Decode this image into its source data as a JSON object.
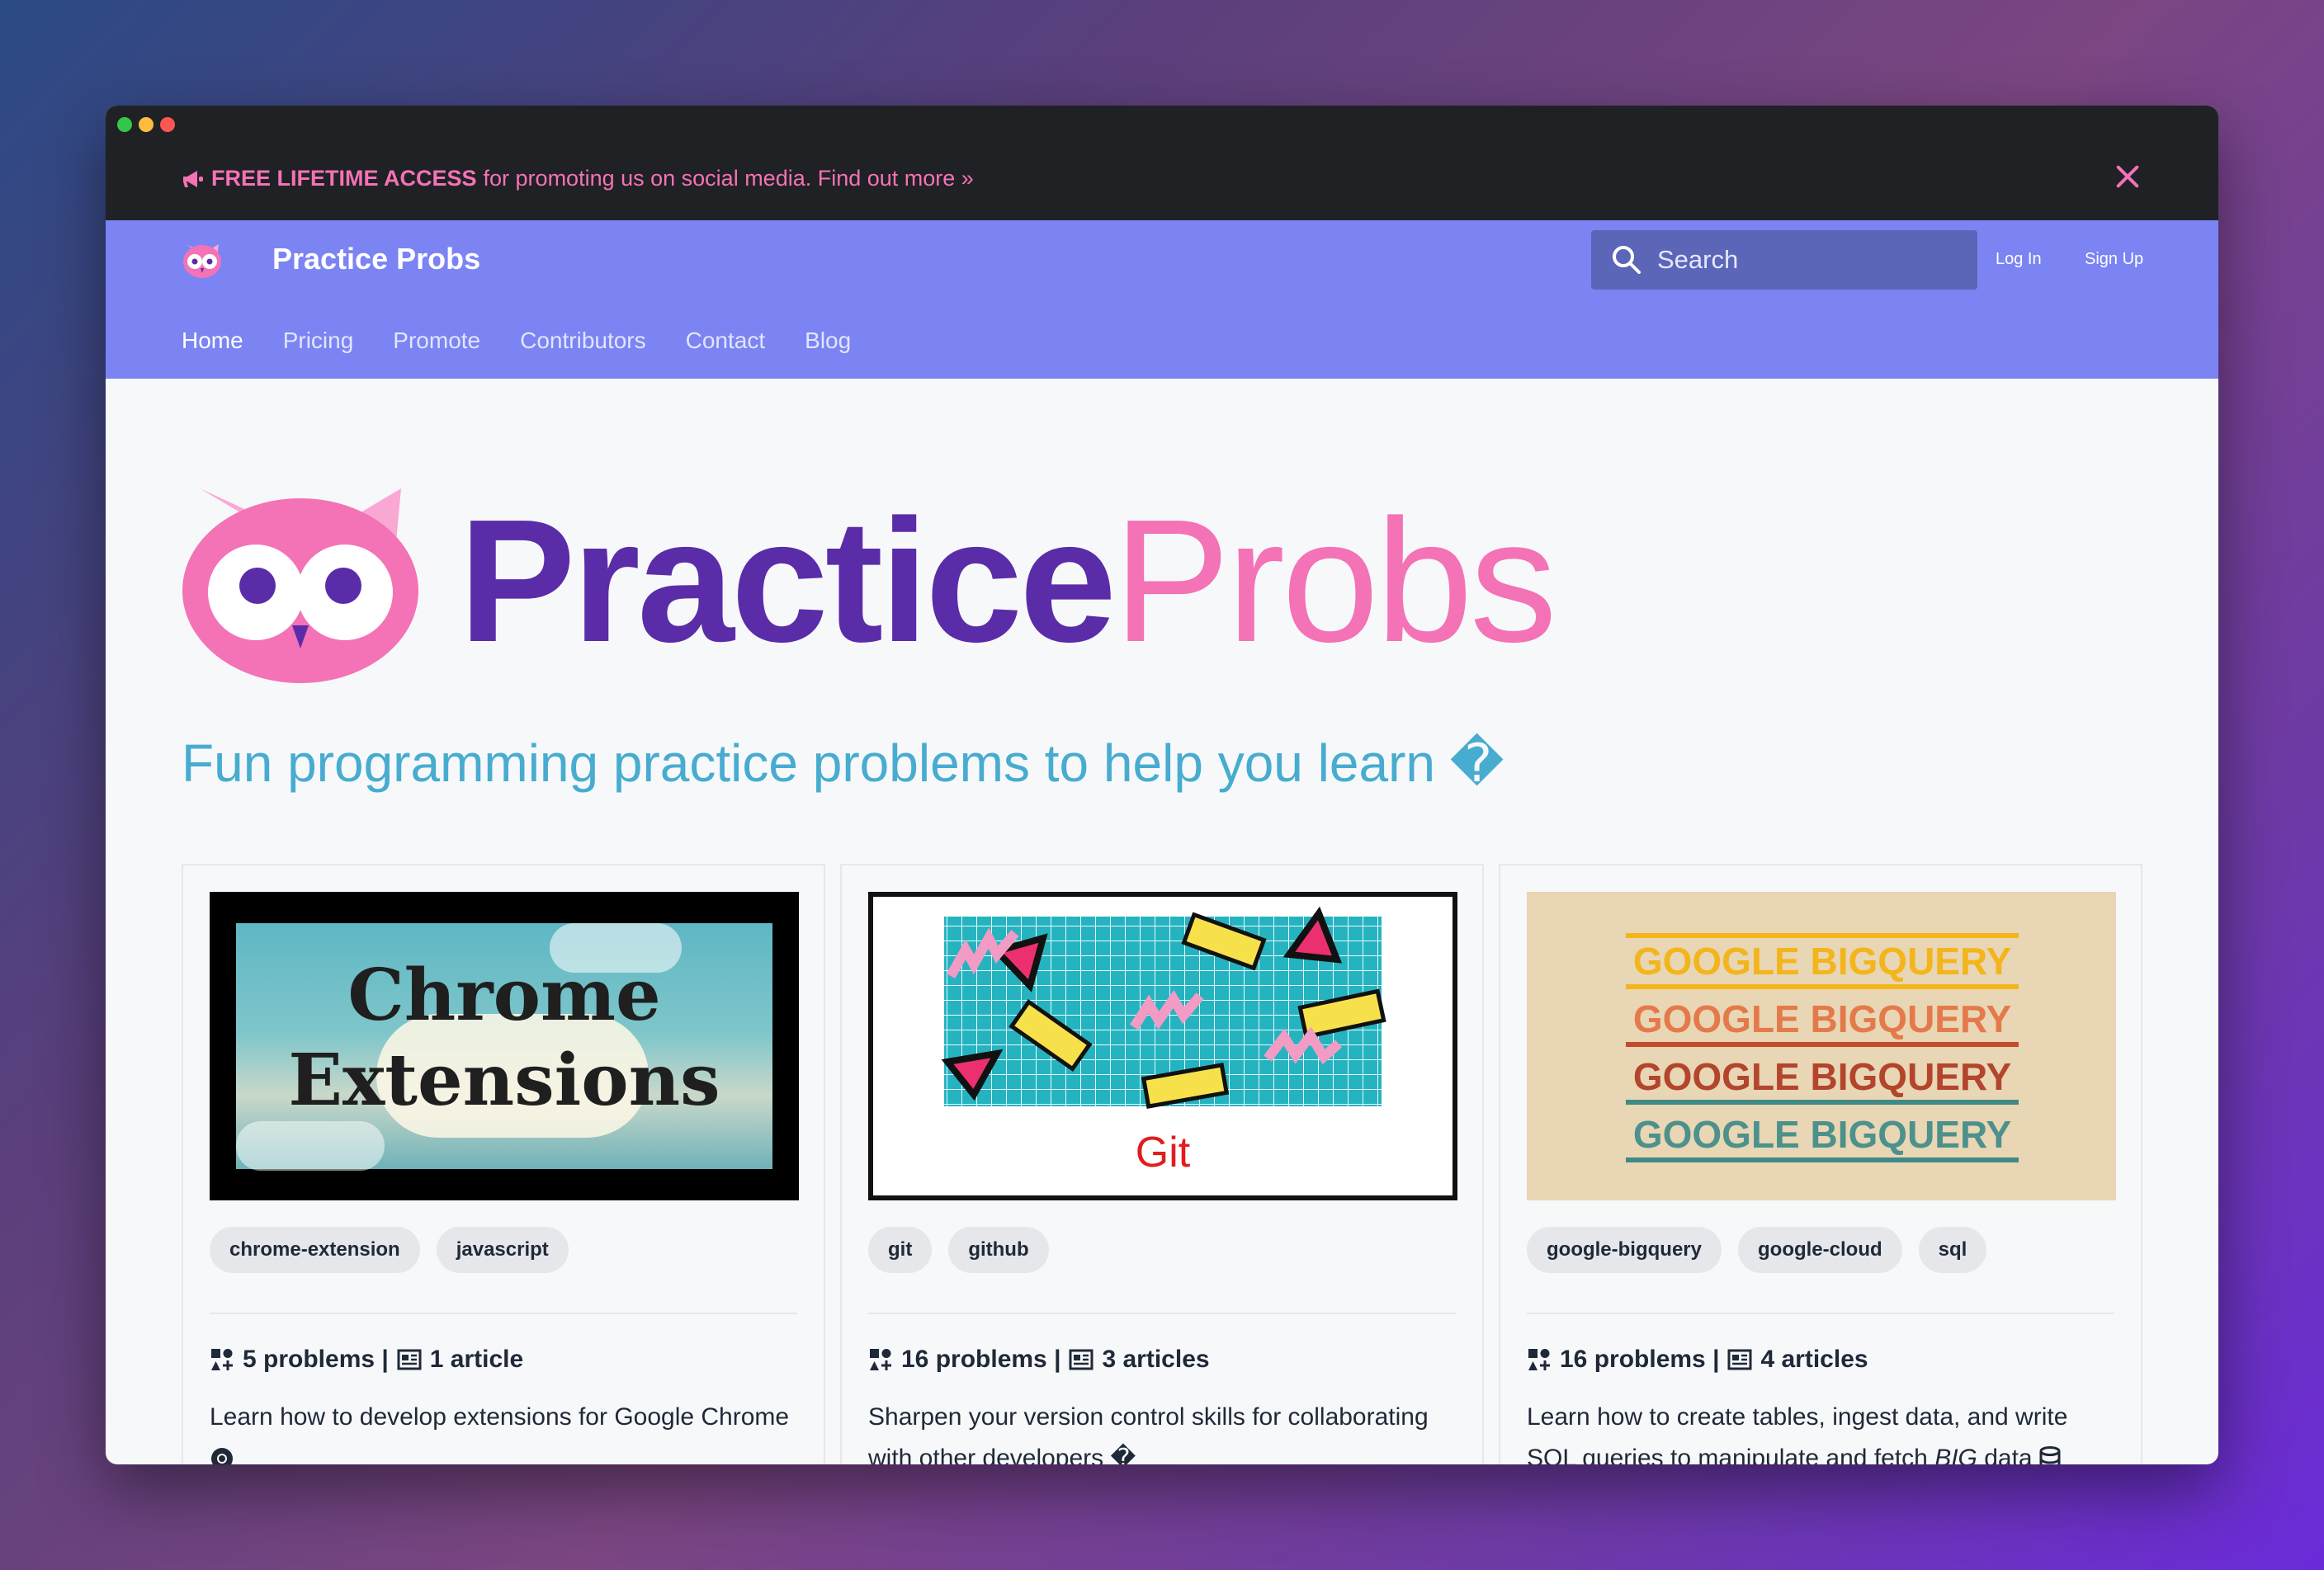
{
  "promo": {
    "strong": "FREE LIFETIME ACCESS",
    "text": "for promoting us on social media. Find out more »"
  },
  "nav": {
    "brand": "Practice Probs",
    "search_placeholder": "Search",
    "login": "Log In",
    "signup": "Sign Up",
    "links": [
      "Home",
      "Pricing",
      "Promote",
      "Contributors",
      "Contact",
      "Blog"
    ]
  },
  "hero": {
    "practice": "Practice",
    "probs": "Probs",
    "tagline": "Fun programming practice problems to help you learn �"
  },
  "cards": [
    {
      "thumb_line1": "Chrome",
      "thumb_line2": "Extensions",
      "tags": [
        "chrome-extension",
        "javascript"
      ],
      "stats": "5 problems | ",
      "stats2": "1 article",
      "desc": "Learn how to develop extensions for Google Chrome"
    },
    {
      "thumb_label": "Git",
      "tags": [
        "git",
        "github"
      ],
      "stats": "16 problems | ",
      "stats2": "3 articles",
      "desc": "Sharpen your version control skills for collaborating with other developers �"
    },
    {
      "thumb_lines": [
        "GOOGLE BIGQUERY",
        "GOOGLE BIGQUERY",
        "GOOGLE BIGQUERY",
        "GOOGLE BIGQUERY"
      ],
      "tags": [
        "google-bigquery",
        "google-cloud",
        "sql"
      ],
      "stats": "16 problems | ",
      "stats2": "4 articles",
      "desc_a": "Learn how to create tables, ingest data, and write SQL queries to manipulate and fetch ",
      "desc_em": "BIG",
      "desc_b": " data"
    }
  ],
  "colors": {
    "navbar": "#7b84f2",
    "promo_text": "#f472b6",
    "brand_purple": "#5b2ca8",
    "brand_pink": "#f472b6",
    "tagline": "#47acd0"
  }
}
